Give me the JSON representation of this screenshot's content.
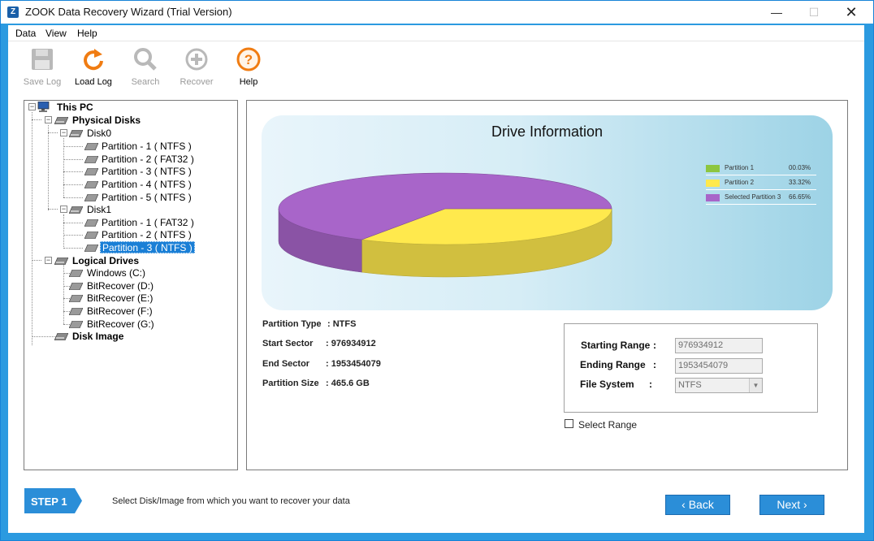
{
  "window": {
    "app_icon": "Z",
    "title": "ZOOK Data Recovery Wizard (Trial Version)",
    "minimize_glyph": "—",
    "maximize_glyph": "☐",
    "close_glyph": "✕"
  },
  "menu": [
    "Data",
    "View",
    "Help"
  ],
  "toolbar": {
    "save_log": {
      "label": "Save Log",
      "icon": "floppy-disk-icon",
      "enabled": false
    },
    "load_log": {
      "label": "Load Log",
      "icon": "refresh-icon",
      "enabled": true
    },
    "search": {
      "label": "Search",
      "icon": "magnifier-icon",
      "enabled": false
    },
    "recover": {
      "label": "Recover",
      "icon": "plus-circle-icon",
      "enabled": false
    },
    "help": {
      "label": "Help",
      "icon": "question-circle-icon",
      "enabled": true
    }
  },
  "tree": {
    "root": "This PC",
    "physical_disks": "Physical Disks",
    "disk0": {
      "label": "Disk0",
      "partitions": [
        "Partition - 1 ( NTFS )",
        "Partition - 2 ( FAT32 )",
        "Partition - 3 ( NTFS )",
        "Partition - 4 ( NTFS )",
        "Partition - 5 ( NTFS )"
      ]
    },
    "disk1": {
      "label": "Disk1",
      "partitions": [
        "Partition - 1 ( FAT32 )",
        "Partition - 2 ( NTFS )",
        "Partition - 3 ( NTFS )"
      ]
    },
    "logical_drives": {
      "label": "Logical Drives",
      "items": [
        "Windows (C:)",
        "BitRecover (D:)",
        "BitRecover (E:)",
        "BitRecover (F:)",
        "BitRecover (G:)"
      ]
    },
    "disk_image": "Disk Image",
    "selected": "Disk1 / Partition - 3 ( NTFS )"
  },
  "chart_data": {
    "type": "pie",
    "title": "Drive Information",
    "categories": [
      "Partition 1",
      "Partition 2",
      "Selected Partition 3"
    ],
    "values": [
      0.03,
      33.32,
      66.65
    ],
    "value_labels": [
      "00.03%",
      "33.32%",
      "66.65%"
    ],
    "colors": [
      "#8dc63f",
      "#ffe94d",
      "#a865c9"
    ],
    "style": "3d",
    "legend_position": "right"
  },
  "info": {
    "partition_type": {
      "label": "Partition Type",
      "value": ": NTFS"
    },
    "start_sector": {
      "label": "Start Sector",
      "value": ": 976934912"
    },
    "end_sector": {
      "label": "End Sector",
      "value": ": 1953454079"
    },
    "partition_size": {
      "label": "Partition Size",
      "value": ": 465.6 GB"
    }
  },
  "range": {
    "starting_range": {
      "label": "Starting Range",
      "colon": ":",
      "value": "976934912"
    },
    "ending_range": {
      "label": "Ending Range",
      "colon": ":",
      "value": "1953454079"
    },
    "file_system": {
      "label": "File System",
      "colon": ":",
      "value": "NTFS"
    },
    "select_range_label": "Select Range",
    "select_range_checked": false
  },
  "footer": {
    "step": "STEP 1",
    "instruction": "Select Disk/Image from which you want to recover your data",
    "back_label": "‹  Back",
    "next_label": "Next  ›"
  },
  "colors": {
    "frame_blue": "#2b9ae0",
    "button_blue": "#2b8ed8",
    "selection_blue": "#1a7fd6",
    "help_orange": "#f07c12"
  }
}
